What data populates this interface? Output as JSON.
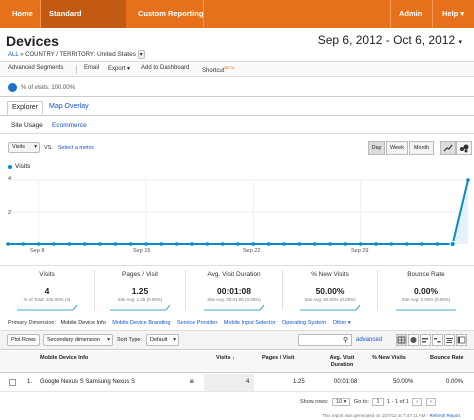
{
  "nav": {
    "home": "Home",
    "standard_reporting": "Standard Reporting",
    "custom_reporting": "Custom Reporting",
    "admin": "Admin",
    "help": "Help"
  },
  "page": {
    "title": "Devices",
    "date_range": "Sep 6, 2012 - Oct 6, 2012",
    "breadcrumb_all": "ALL",
    "breadcrumb_sep": "»",
    "breadcrumb_dim": "COUNTRY / TERRITORY:",
    "breadcrumb_value": "United States"
  },
  "toolbar": {
    "advanced_segments": "Advanced Segments",
    "email": "Email",
    "export": "Export",
    "add_to_dashboard": "Add to Dashboard",
    "shortcut": "Shortcut",
    "beta": "BETA"
  },
  "segment": {
    "text": "% of visits: 100.00%"
  },
  "tabs": {
    "explorer": "Explorer",
    "map_overlay": "Map Overlay"
  },
  "subtabs": {
    "site_usage": "Site Usage",
    "ecommerce": "Ecommerce"
  },
  "chart_controls": {
    "metric": "Visits",
    "vs": "VS.",
    "select_metric": "Select a metric",
    "day": "Day",
    "week": "Week",
    "month": "Month"
  },
  "chart_data": {
    "type": "line",
    "series": [
      {
        "name": "Visits",
        "values": [
          0,
          0,
          0,
          0,
          0,
          0,
          0,
          0,
          0,
          0,
          0,
          0,
          0,
          0,
          0,
          0,
          0,
          0,
          0,
          0,
          0,
          0,
          0,
          0,
          0,
          0,
          0,
          0,
          0,
          0,
          4
        ]
      }
    ],
    "x": [
      "Sep 6",
      "Sep 7",
      "Sep 8",
      "Sep 9",
      "Sep 10",
      "Sep 11",
      "Sep 12",
      "Sep 13",
      "Sep 14",
      "Sep 15",
      "Sep 16",
      "Sep 17",
      "Sep 18",
      "Sep 19",
      "Sep 20",
      "Sep 21",
      "Sep 22",
      "Sep 23",
      "Sep 24",
      "Sep 25",
      "Sep 26",
      "Sep 27",
      "Sep 28",
      "Sep 29",
      "Sep 30",
      "Oct 1",
      "Oct 2",
      "Oct 3",
      "Oct 4",
      "Oct 5",
      "Oct 6"
    ],
    "x_tick_labels": [
      "Sep 8",
      "Sep 15",
      "Sep 22",
      "Sep 29"
    ],
    "y_tick_labels": [
      "4",
      "2"
    ],
    "ylim": [
      0,
      4
    ],
    "grid": true,
    "legend": "top-left",
    "color": "#058dc7"
  },
  "scorecards": [
    {
      "title": "Visits",
      "value": "4",
      "sub": "% of Total: 100.00% (4)"
    },
    {
      "title": "Pages / Visit",
      "value": "1.25",
      "sub": "Site Avg: 1.25 (0.00%)"
    },
    {
      "title": "Avg. Visit Duration",
      "value": "00:01:08",
      "sub": "Site Avg: 00:01:08 (0.00%)"
    },
    {
      "title": "% New Visits",
      "value": "50.00%",
      "sub": "Site Avg: 50.00% (0.00%)"
    },
    {
      "title": "Bounce Rate",
      "value": "0.00%",
      "sub": "Site Avg: 0.00% (0.00%)"
    }
  ],
  "primary_dimension": {
    "label": "Primary Dimension:",
    "current": "Mobile Device Info",
    "options": [
      "Mobile Device Branding",
      "Service Provider",
      "Mobile Input Selector",
      "Operating System",
      "Other"
    ]
  },
  "table_controls": {
    "plot_rows": "Plot Rows",
    "secondary_dimension": "Secondary dimension",
    "sort_type_label": "Sort Type:",
    "sort_type": "Default",
    "advanced": "advanced"
  },
  "table": {
    "headers": [
      "Mobile Device Info",
      "Visits",
      "Pages / Visit",
      "Avg. Visit Duration",
      "% New Visits",
      "Bounce Rate"
    ],
    "rows": [
      {
        "index": "1.",
        "device": "Google Nexus S Samsung Nexus S",
        "visits": "4",
        "pages_visit": "1.25",
        "duration": "00:01:08",
        "new_visits": "50.00%",
        "bounce": "0.00%"
      }
    ]
  },
  "footer": {
    "show_rows": "Show rows:",
    "rows_value": "10",
    "goto": "Go to:",
    "goto_value": "1",
    "range": "1 - 1 of 1",
    "note": "This report was generated on 10/7/12 at 7:47:11 AM -",
    "refresh": "Refresh Report"
  }
}
